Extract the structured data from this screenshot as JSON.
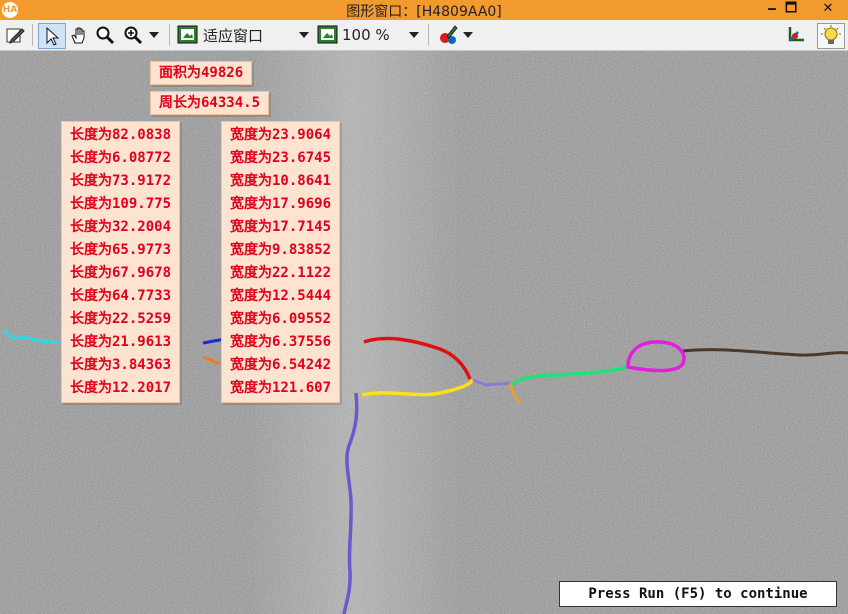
{
  "window": {
    "title": "图形窗口：[H4809AA0]",
    "logo_text": "HA",
    "minimize_glyph": "🗕",
    "maximize_glyph": "🗖",
    "close_glyph": "✕"
  },
  "toolbar": {
    "fit_option": "适应窗口",
    "zoom_value": "100 %",
    "icons": [
      "edit-icon",
      "select-arrow-icon",
      "pan-hand-icon",
      "magnifier-icon",
      "zoom-in-icon",
      "fit-window-icon",
      "zoom-image-icon",
      "color-palette-icon",
      "axes-icon",
      "lightbulb-icon"
    ]
  },
  "labels": {
    "area": "面积为49826",
    "perimeter": "周长为64334.5",
    "lengths": [
      "长度为82.0838",
      "长度为6.08772",
      "长度为73.9172",
      "长度为109.775",
      "长度为32.2004",
      "长度为65.9773",
      "长度为67.9678",
      "长度为64.7733",
      "长度为22.5259",
      "长度为21.9613",
      "长度为3.84363",
      "长度为12.2017"
    ],
    "widths": [
      "宽度为23.9064",
      "宽度为23.6745",
      "宽度为10.8641",
      "宽度为17.9696",
      "宽度为17.7145",
      "宽度为9.83852",
      "宽度为22.1122",
      "宽度为12.5444",
      "宽度为6.09552",
      "宽度为6.37556",
      "宽度为6.54242",
      "宽度为121.607"
    ]
  },
  "status_message": "Press Run (F5) to continue",
  "colors": {
    "title_bar": "#f39a2e",
    "label_background": "#fde3d0",
    "label_text": "#e0001b",
    "crack_colors": [
      "#2fd6e6",
      "#1b2bd6",
      "#f07a2a",
      "#e01010",
      "#ffe014",
      "#8a7bd6",
      "#6a5acd",
      "#f0a020",
      "#22e07a",
      "#e21ee0",
      "#5b3f2a"
    ]
  }
}
